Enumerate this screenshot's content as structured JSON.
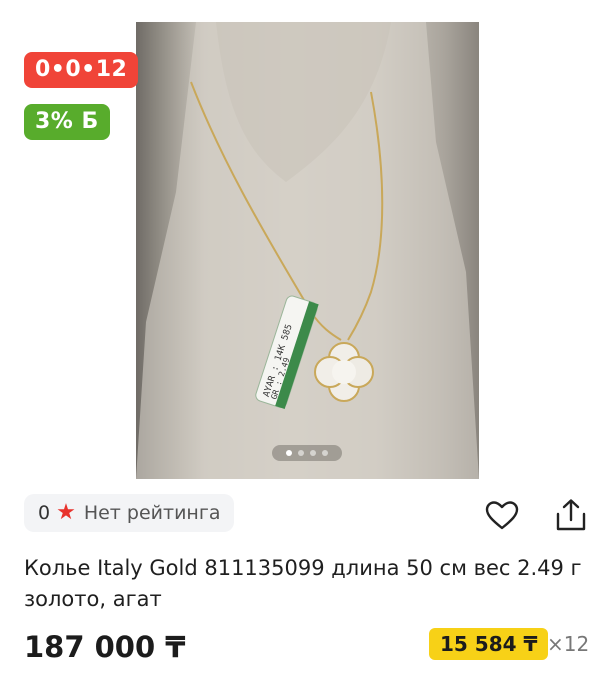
{
  "badges": {
    "installment": "0•0•12",
    "bonus": "3% Б"
  },
  "photo": {
    "tag_line1": "AYAR : 14K 585",
    "tag_line2": "GR : 2.49",
    "pages": 4,
    "active_page": 1
  },
  "rating": {
    "value": "0",
    "label": "Нет рейтинга"
  },
  "product": {
    "title": "Колье Italy Gold 811135099 длина 50 см вес 2.49 г золото, агат"
  },
  "price": {
    "full": "187 000 ₸",
    "monthly": "15 584 ₸",
    "months": "×12"
  },
  "colors": {
    "installment_badge": "#f04438",
    "bonus_badge": "#58ac2c",
    "monthly_highlight": "#f7d117",
    "star": "#e8322c"
  },
  "icons": {
    "rating": "star-icon",
    "favorite": "heart-icon",
    "share": "share-icon"
  }
}
